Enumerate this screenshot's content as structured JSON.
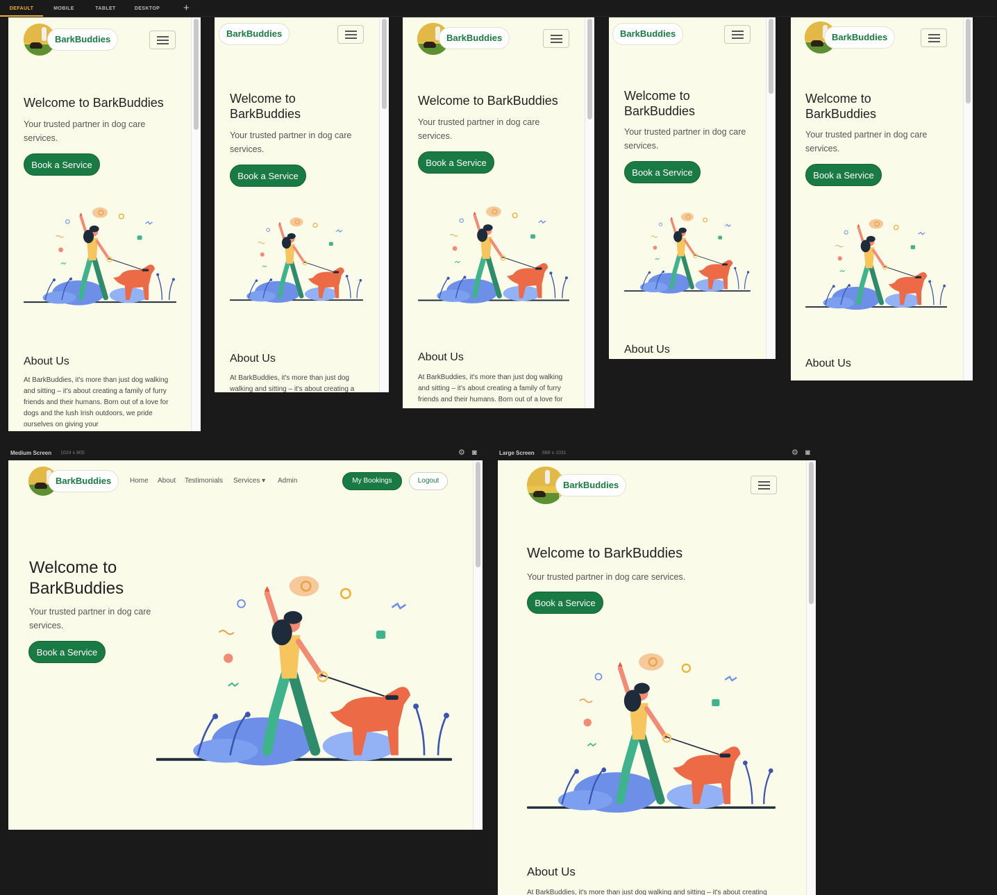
{
  "toolbar": {
    "tabs": [
      "DEFAULT",
      "MOBILE",
      "TABLET",
      "DESKTOP"
    ],
    "add_icon": "plus-icon",
    "accent_color": "#f0b032"
  },
  "site": {
    "brand": "BarkBuddies",
    "hero_title": "Welcome to BarkBuddies",
    "hero_sub": "Your trusted partner in dog care services.",
    "cta": "Book a Service",
    "about_title": "About Us",
    "about_text": "At BarkBuddies, it's more than just dog walking and sitting – it's about creating a family of furry friends and their humans. Born out of a love for dogs and the lush Irish outdoors, we pride ourselves on giving your",
    "brand_color": "#1a7a44",
    "bg_color": "#fbfbea"
  },
  "nav": {
    "home": "Home",
    "about": "About",
    "testimonials": "Testimonials",
    "services": "Services",
    "admin": "Admin",
    "bookings": "My Bookings",
    "logout": "Logout"
  },
  "panels": {
    "medium_label": "Medium Screen",
    "medium_size": "1024 x 800",
    "large_label": "Large Screen",
    "large_size": "688 x 1031",
    "settings_icon": "gear-icon",
    "screenshot_icon": "camera-icon"
  },
  "icons": {
    "menu": "hamburger-menu-icon",
    "dropdown": "caret-down-icon",
    "illustration": "woman-walking-dog-illustration"
  }
}
